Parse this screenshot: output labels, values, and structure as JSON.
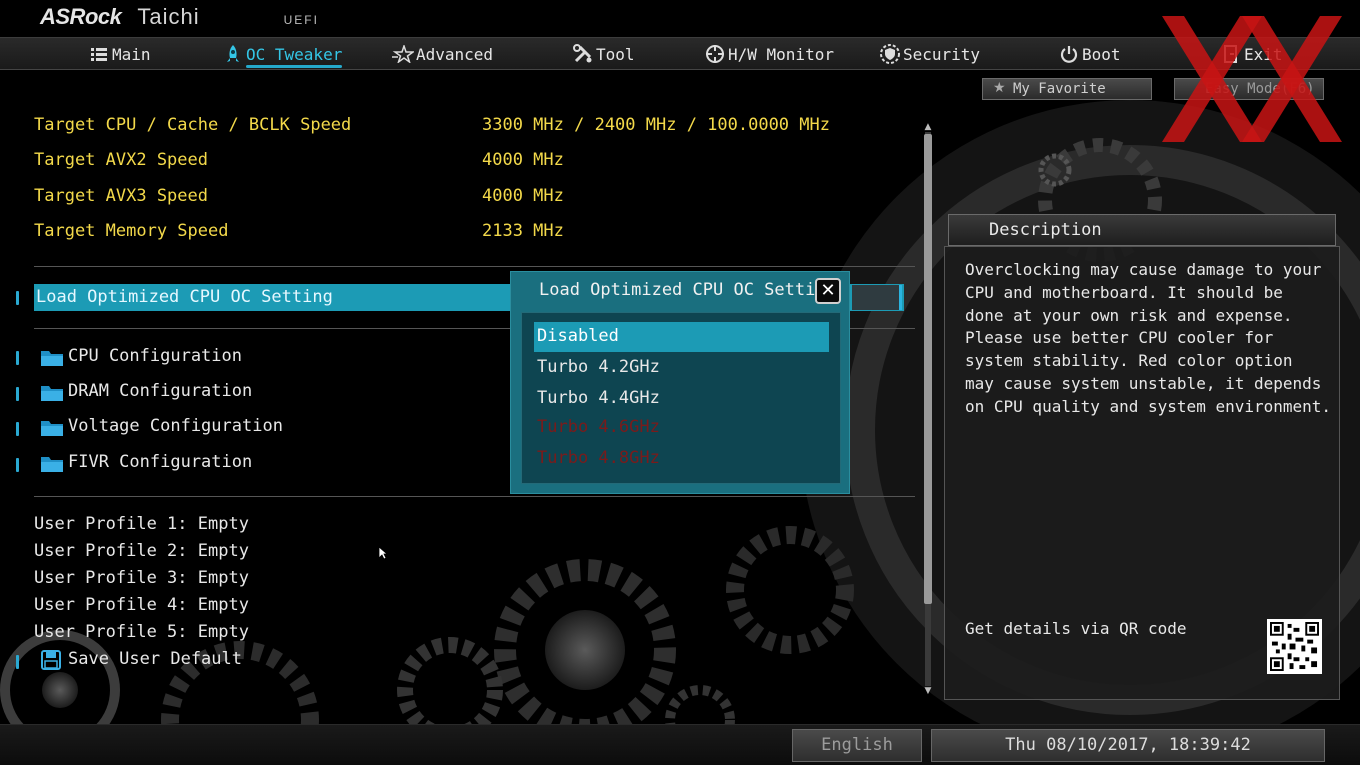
{
  "header": {
    "brand": "ASRock",
    "model": "Taichi",
    "firmware": "UEFI"
  },
  "menu": [
    {
      "label": "Main",
      "icon": "list-icon"
    },
    {
      "label": "OC Tweaker",
      "icon": "rocket-icon",
      "active": true
    },
    {
      "label": "Advanced",
      "icon": "star-icon"
    },
    {
      "label": "Tool",
      "icon": "wrench-icon"
    },
    {
      "label": "H/W Monitor",
      "icon": "crosshair-icon"
    },
    {
      "label": "Security",
      "icon": "shield-icon"
    },
    {
      "label": "Boot",
      "icon": "power-icon"
    },
    {
      "label": "Exit",
      "icon": "exit-icon"
    }
  ],
  "favorites": {
    "my_favorite": "My Favorite",
    "easy_mode": "Easy Mode(F6)"
  },
  "targets": [
    {
      "label": "Target CPU / Cache / BCLK Speed",
      "value": "3300 MHz / 2400 MHz / 100.0000 MHz"
    },
    {
      "label": "Target AVX2 Speed",
      "value": "4000 MHz"
    },
    {
      "label": "Target AVX3 Speed",
      "value": "4000 MHz"
    },
    {
      "label": "Target Memory Speed",
      "value": "2133 MHz"
    }
  ],
  "highlighted": {
    "label": "Load Optimized CPU OC Setting"
  },
  "configs": [
    "CPU Configuration",
    "DRAM Configuration",
    "Voltage Configuration",
    "FIVR Configuration"
  ],
  "profiles": [
    "User Profile 1: Empty",
    "User Profile 2: Empty",
    "User Profile 3: Empty",
    "User Profile 4: Empty",
    "User Profile 5: Empty"
  ],
  "save_default": "Save User Default",
  "modal": {
    "title": "Load Optimized CPU OC Setting",
    "close": "✕",
    "options": [
      {
        "label": "Disabled",
        "state": "selected"
      },
      {
        "label": "Turbo 4.2GHz",
        "state": "normal"
      },
      {
        "label": "Turbo 4.4GHz",
        "state": "normal"
      },
      {
        "label": "Turbo 4.6GHz",
        "state": "risky"
      },
      {
        "label": "Turbo 4.8GHz",
        "state": "risky"
      }
    ]
  },
  "description": {
    "title": "Description",
    "text": "Overclocking may cause damage to your\nCPU and motherboard. It should be\ndone at your own risk and expense.\nPlease use better CPU cooler for\nsystem stability. Red color option\nmay cause system unstable, it depends\non CPU quality and system environment.",
    "qr_label": "Get details via QR code"
  },
  "footer": {
    "language": "English",
    "datetime": "Thu 08/10/2017, 18:39:42"
  },
  "colors": {
    "accent": "#1c9bb5",
    "yellow_text": "#f3d94a",
    "risky_option": "#7a1b1b"
  }
}
